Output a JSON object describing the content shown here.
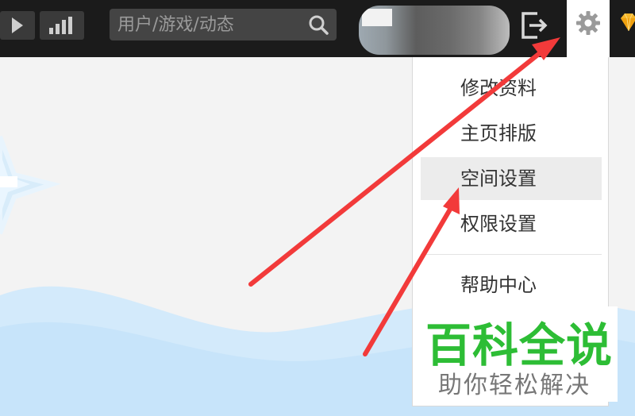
{
  "search": {
    "placeholder": "用户/游戏/动态"
  },
  "menu": {
    "items": [
      {
        "label": "修改资料"
      },
      {
        "label": "主页排版"
      },
      {
        "label": "空间设置"
      },
      {
        "label": "权限设置"
      },
      {
        "label": "帮助中心"
      }
    ],
    "highlighted": "空间设置"
  },
  "watermark": {
    "title": "百科全说",
    "subtitle": "助你轻松解决"
  },
  "colors": {
    "topbar": "#1b1b1b",
    "button_bg": "#3a3a3a",
    "search_bg": "#444444",
    "menu_hover": "#ececec",
    "arrow": "#f23a3a",
    "watermark_green": "#2dbd35",
    "wave": "#cfe8fb"
  },
  "icons": [
    "play-icon",
    "stats-icon",
    "search-icon",
    "logout-icon",
    "gear-icon",
    "diamond-icon"
  ]
}
